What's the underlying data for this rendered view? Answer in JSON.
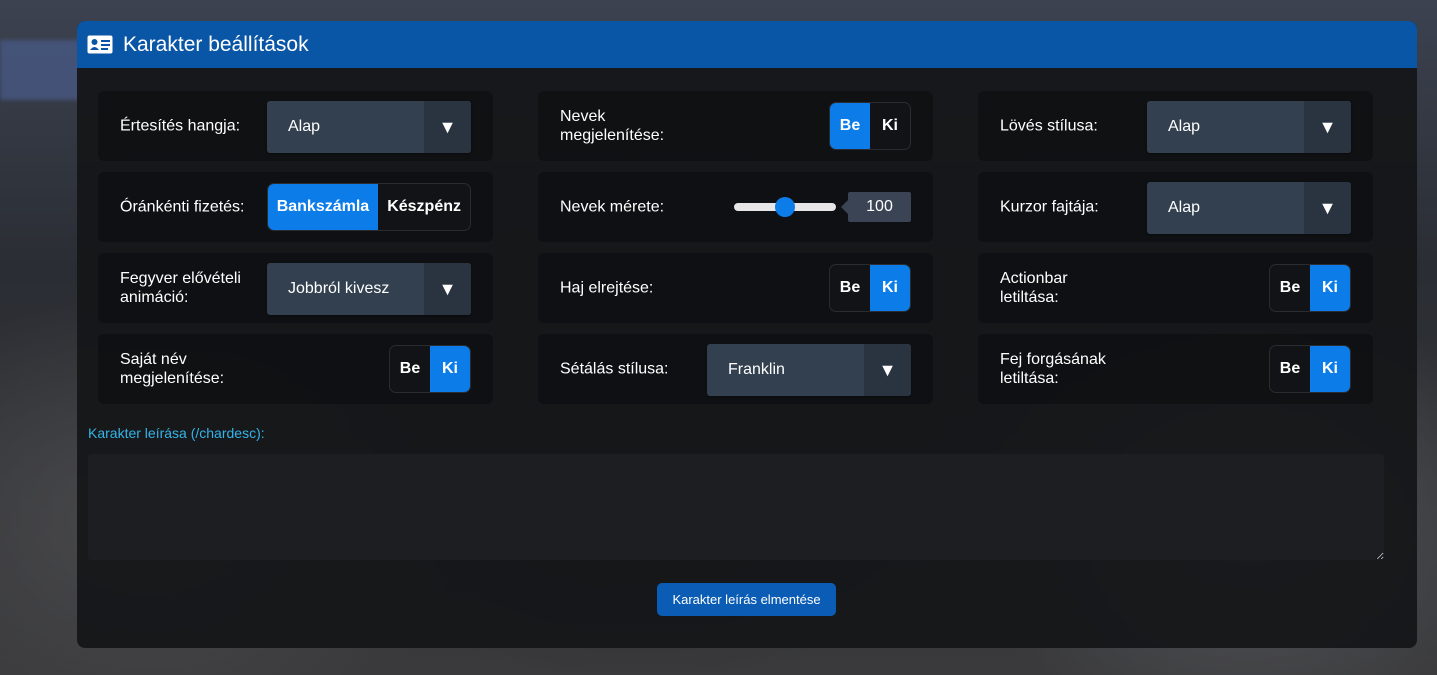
{
  "header": {
    "title": "Karakter beállítások",
    "icon": "id-card-icon"
  },
  "columns": [
    [
      {
        "name": "notification-sound",
        "label": "Értesítés hangja:",
        "type": "select",
        "value": "Alap"
      },
      {
        "name": "hourly-payment",
        "label": "Óránkénti fizetés:",
        "type": "toggle",
        "options": [
          "Bankszámla",
          "Készpénz"
        ],
        "selected": "Bankszámla"
      },
      {
        "name": "weapon-draw-animation",
        "label": "Fegyver elővételi animáció:",
        "type": "select",
        "value": "Jobbról kivesz"
      },
      {
        "name": "own-name-display",
        "label": "Saját név megjelenítése:",
        "type": "toggle",
        "options": [
          "Be",
          "Ki"
        ],
        "selected": "Ki"
      }
    ],
    [
      {
        "name": "names-display",
        "label": "Nevek megjelenítése:",
        "type": "toggle",
        "options": [
          "Be",
          "Ki"
        ],
        "selected": "Be"
      },
      {
        "name": "names-size",
        "label": "Nevek mérete:",
        "type": "slider",
        "value": "100"
      },
      {
        "name": "hide-hair",
        "label": "Haj elrejtése:",
        "type": "toggle",
        "options": [
          "Be",
          "Ki"
        ],
        "selected": "Ki"
      },
      {
        "name": "walking-style",
        "label": "Sétálás stílusa:",
        "type": "select",
        "value": "Franklin"
      }
    ],
    [
      {
        "name": "shooting-style",
        "label": "Lövés stílusa:",
        "type": "select",
        "value": "Alap"
      },
      {
        "name": "cursor-type",
        "label": "Kurzor fajtája:",
        "type": "select",
        "value": "Alap"
      },
      {
        "name": "disable-actionbar",
        "label": "Actionbar letiltása:",
        "type": "toggle",
        "options": [
          "Be",
          "Ki"
        ],
        "selected": "Ki"
      },
      {
        "name": "disable-head-rotation",
        "label": "Fej forgásának letiltása:",
        "type": "toggle",
        "options": [
          "Be",
          "Ki"
        ],
        "selected": "Ki"
      }
    ]
  ],
  "slider_level_fraction": 0.5,
  "description": {
    "label": "Karakter leírása (/chardesc):",
    "value": "",
    "save_label": "Karakter leírás elmentése"
  },
  "colors": {
    "header": "#0a56a6",
    "accent": "#0c7ce8",
    "link_label": "#34b4e8",
    "select_bg": "#33404f"
  }
}
